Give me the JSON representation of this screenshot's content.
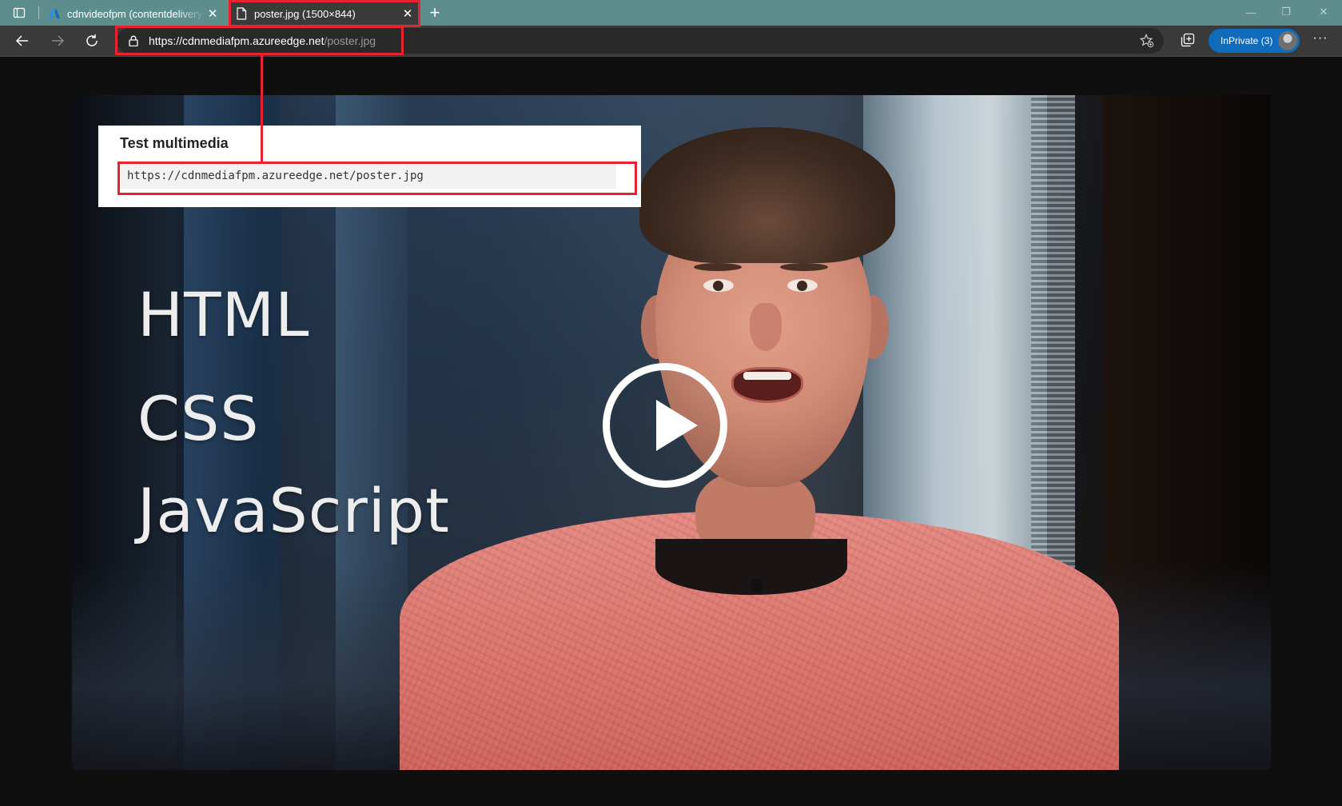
{
  "tabs": [
    {
      "label": "cdnvideofpm (contentdeliverynetwork) - Microsoft Azure",
      "icon": "azure-logo-icon",
      "active": false
    },
    {
      "label": "poster.jpg (1500×844)",
      "icon": "file-icon",
      "active": true
    }
  ],
  "toolbar": {
    "url_domain": "https://cdnmediafpm.azureedge.net",
    "url_path": "/poster.jpg",
    "inprivate_label": "InPrivate (3)"
  },
  "poster": {
    "words": [
      "HTML",
      "CSS",
      "JavaScript"
    ]
  },
  "callout": {
    "title": "Test multimedia",
    "field_value": "https://cdnmediafpm.azureedge.net/poster.jpg"
  },
  "colors": {
    "tabstrip": "#5e8e8c",
    "toolbar": "#3a3a3a",
    "highlight": "#e8222e",
    "inprivate": "#0f6cbd"
  }
}
